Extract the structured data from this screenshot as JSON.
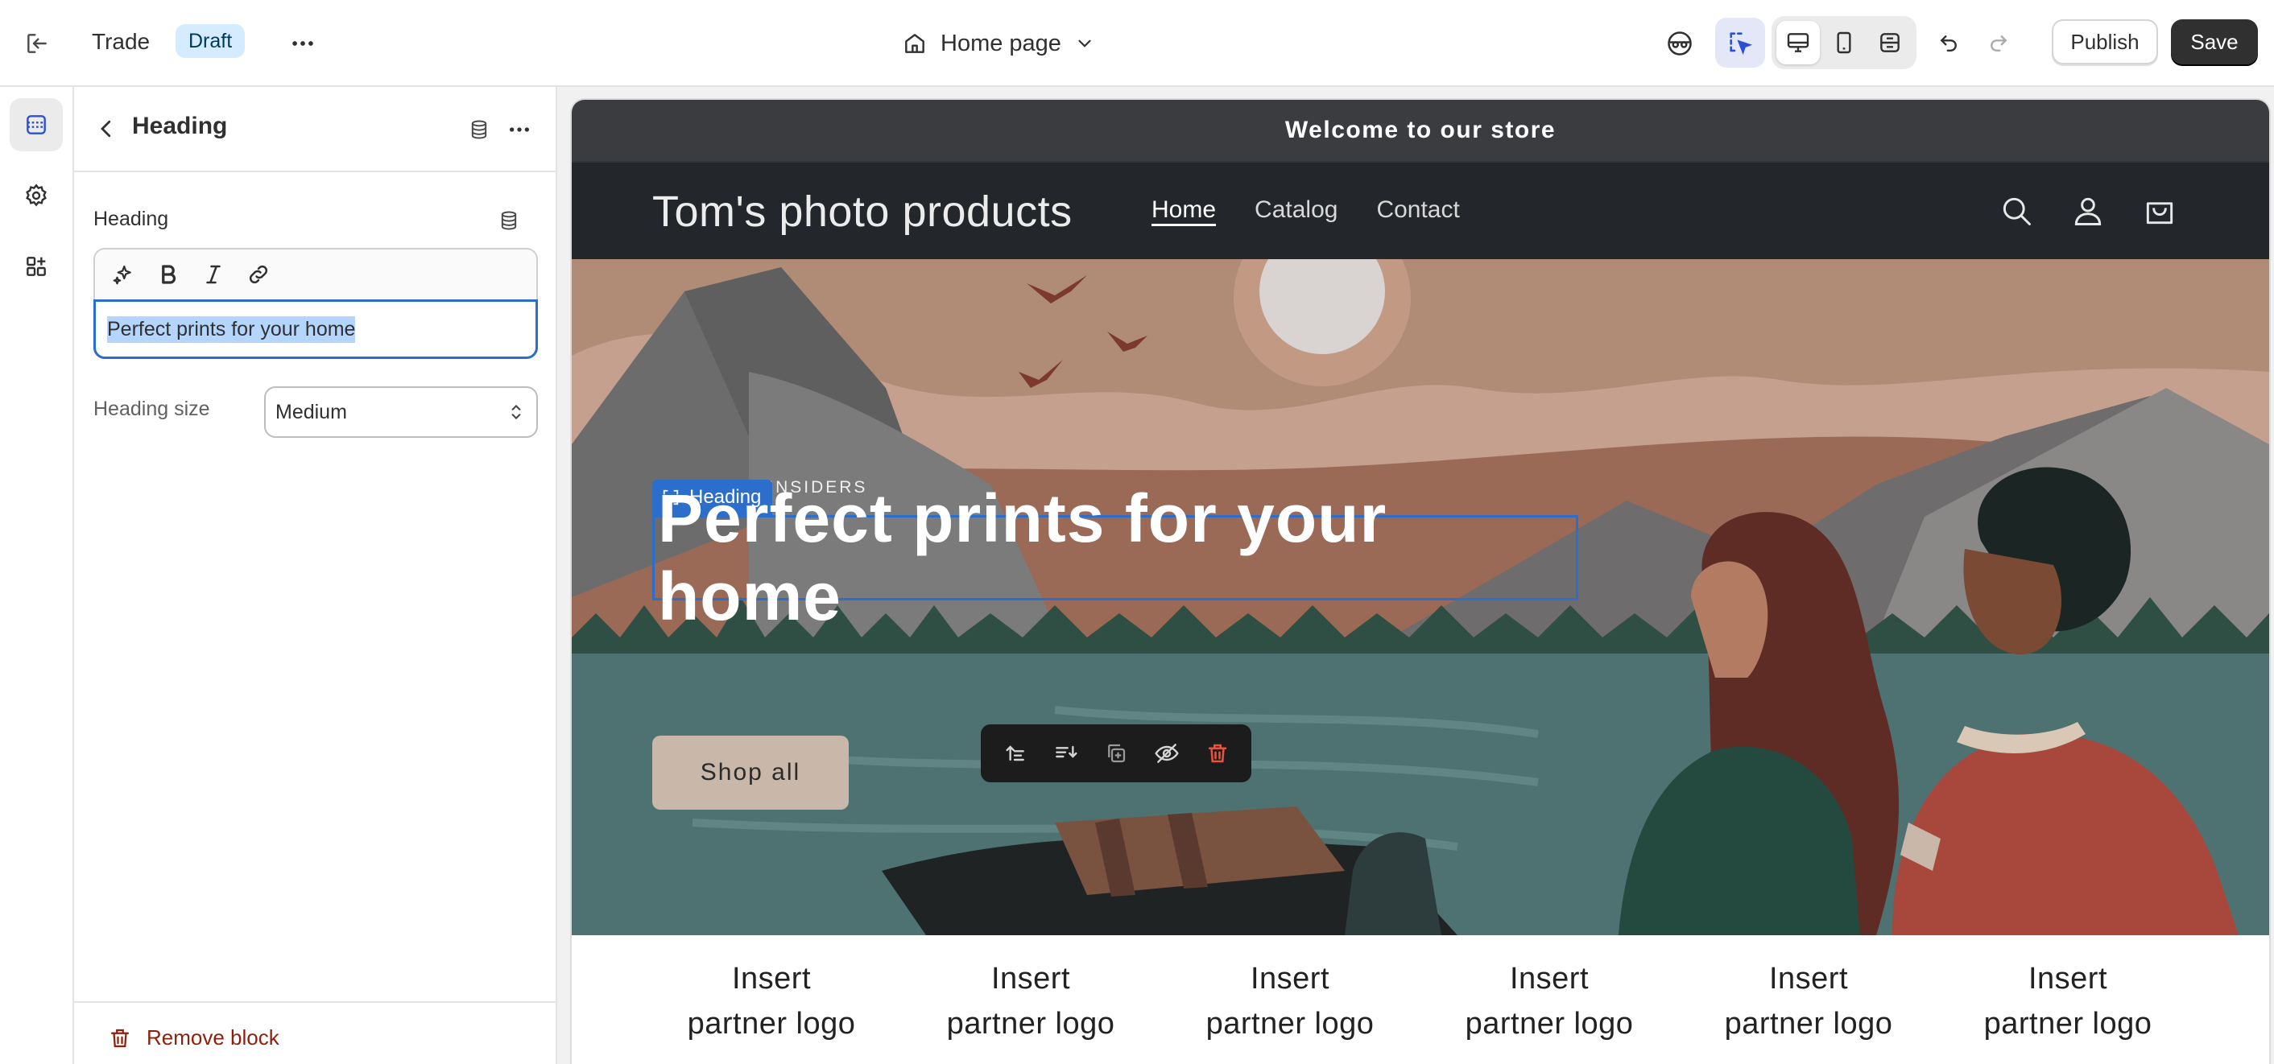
{
  "topbar": {
    "store_name": "Trade",
    "status_badge": "Draft",
    "page_picker": "Home page",
    "publish_label": "Publish",
    "save_label": "Save"
  },
  "panel": {
    "title": "Heading",
    "field_label": "Heading",
    "heading_value": "Perfect prints for your home",
    "size_label": "Heading size",
    "size_value": "Medium",
    "remove_label": "Remove block"
  },
  "preview": {
    "announcement": "Welcome to our store",
    "store_logo": "Tom's photo products",
    "nav": [
      "Home",
      "Catalog",
      "Contact"
    ],
    "hero_subheading": "USTRY INSIDERS",
    "selection_tag": "Heading",
    "hero_heading": "Perfect prints for your home",
    "hero_button": "Shop all",
    "partner_logos": [
      [
        "Insert",
        "partner logo"
      ],
      [
        "Insert",
        "partner logo"
      ],
      [
        "Insert",
        "partner logo"
      ],
      [
        "Insert",
        "partner logo"
      ],
      [
        "Insert",
        "partner logo"
      ],
      [
        "Insert",
        "partner logo"
      ]
    ]
  },
  "colors": {
    "accent": "#2c6ecb",
    "save_button": "#303030",
    "draft_badge": "#d5ebff",
    "remove_text": "#8e1f0b",
    "delete_icon": "#e8533f"
  },
  "icons": {
    "exit": "exit-icon",
    "more": "more-horizontal-icon",
    "page": "home-icon",
    "inspect": "inspector-icon",
    "select": "select-cursor-icon",
    "desktop": "desktop-icon",
    "mobile": "mobile-icon",
    "fullwidth": "fullwidth-icon",
    "undo": "undo-icon",
    "redo": "redo-icon"
  }
}
